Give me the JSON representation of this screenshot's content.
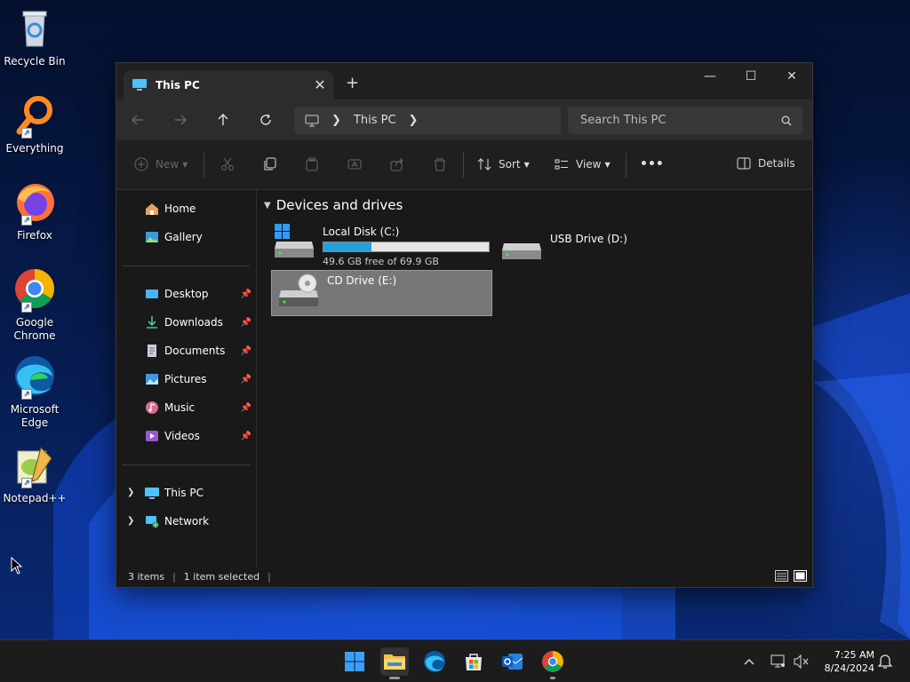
{
  "desktop": {
    "icons": [
      {
        "label": "Recycle Bin"
      },
      {
        "label": "Everything"
      },
      {
        "label": "Firefox"
      },
      {
        "label": "Google Chrome"
      },
      {
        "label": "Microsoft Edge"
      },
      {
        "label": "Notepad++"
      }
    ]
  },
  "window": {
    "tab_title": "This PC",
    "new_tab_glyph": "+",
    "controls": {
      "minimize": "—",
      "maximize": "☐",
      "close": "✕"
    },
    "address": {
      "crumbs": [
        "This PC"
      ],
      "search_placeholder": "Search This PC"
    },
    "toolbar": {
      "new_label": "New",
      "sort_label": "Sort",
      "view_label": "View",
      "more_label": "•••",
      "details_label": "Details"
    },
    "nav": {
      "home": "Home",
      "gallery": "Gallery",
      "desktop": "Desktop",
      "downloads": "Downloads",
      "documents": "Documents",
      "pictures": "Pictures",
      "music": "Music",
      "videos": "Videos",
      "this_pc": "This PC",
      "network": "Network"
    },
    "content": {
      "group_title": "Devices and drives",
      "drives": [
        {
          "name": "Local Disk (C:)",
          "free_text": "49.6 GB free of 69.9 GB",
          "used_fraction": 0.29
        },
        {
          "name": "USB Drive (D:)"
        },
        {
          "name": "CD Drive (E:)"
        }
      ]
    },
    "status": {
      "items": "3 items",
      "selected": "1 item selected"
    }
  },
  "taskbar": {
    "clock_time": "7:25 AM",
    "clock_date": "8/24/2024"
  },
  "colors": {
    "accent": "#26a0da",
    "window_bg": "#191919",
    "selected_bg": "#777777"
  }
}
